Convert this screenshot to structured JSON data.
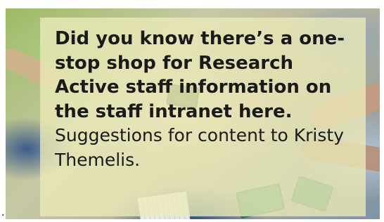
{
  "message": {
    "headline": "Did you know there’s a one-stop shop for Research Active staff information on the staff intranet here.",
    "suggestion": "Suggestions for content to Kristy Themelis."
  },
  "stray_mark": "."
}
